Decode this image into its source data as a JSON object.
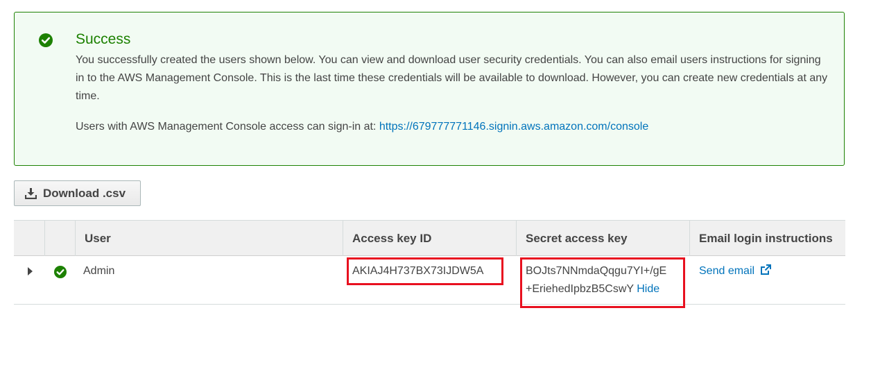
{
  "alert": {
    "title": "Success",
    "message": "You successfully created the users shown below. You can view and download user security credentials. You can also email users instructions for signing in to the AWS Management Console. This is the last time these credentials will be available to download. However, you can create new credentials at any time.",
    "signin_prefix": "Users with AWS Management Console access can sign-in at: ",
    "signin_url": "https://679777771146.signin.aws.amazon.com/console",
    "icon": "check-circle-icon"
  },
  "toolbar": {
    "download_label": "Download .csv",
    "download_icon": "download-icon"
  },
  "table": {
    "columns": [
      "User",
      "Access key ID",
      "Secret access key",
      "Email login instructions"
    ],
    "rows": [
      {
        "user": "Admin",
        "access_key_id": "AKIAJ4H737BX73IJDW5A",
        "secret_line1": "BOJts7NNmdaQqgu7YI+/gE",
        "secret_line2": "+EriehedIpbzB5CswY",
        "hide_label": "Hide",
        "email_action": "Send email",
        "status_icon": "check-circle-icon"
      }
    ]
  },
  "colors": {
    "success_green": "#1d8102",
    "link_blue": "#0073bb",
    "highlight_red": "#e8101f"
  }
}
